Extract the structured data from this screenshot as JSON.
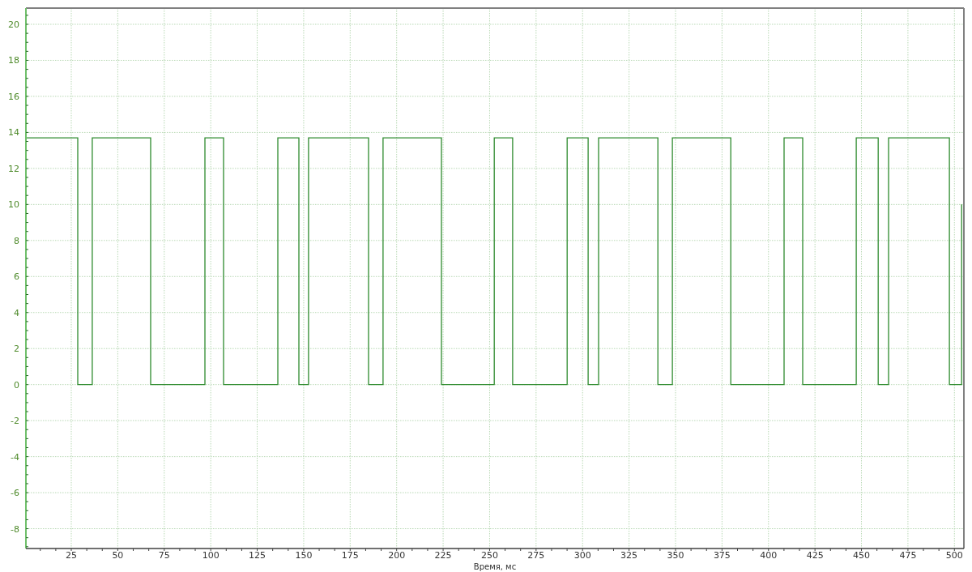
{
  "chart_data": {
    "type": "line",
    "grid": true,
    "xlabel": "Время, мс",
    "xlim": [
      0.6,
      505.1
    ],
    "ylim": [
      -9.1,
      20.9
    ],
    "xticks": [
      25,
      50,
      75,
      100,
      125,
      150,
      175,
      200,
      225,
      250,
      275,
      300,
      325,
      350,
      375,
      400,
      425,
      450,
      475,
      500
    ],
    "yticks": [
      -8,
      -6,
      -4,
      -2,
      0,
      2,
      4,
      6,
      8,
      10,
      12,
      14,
      16,
      18,
      20
    ],
    "x": [
      0.6,
      28.5,
      28.5,
      36.3,
      36.3,
      67.7,
      67.7,
      96.9,
      96.9,
      106.9,
      106.9,
      136.1,
      136.1,
      147.4,
      147.4,
      152.6,
      152.6,
      184.9,
      184.9,
      192.7,
      192.7,
      224.1,
      224.1,
      252.5,
      252.5,
      262.4,
      262.4,
      291.7,
      291.7,
      303,
      303,
      308.6,
      308.6,
      340.5,
      340.5,
      348.3,
      348.3,
      379.7,
      379.7,
      408.4,
      408.4,
      418.4,
      418.4,
      447.2,
      447.2,
      459,
      459,
      464.6,
      464.6,
      497.3,
      497.3,
      503.9,
      503.9
    ],
    "series": [
      {
        "color": "#2e8b2e",
        "values": [
          13.7,
          13.7,
          0,
          0,
          13.7,
          13.7,
          0,
          0,
          13.7,
          13.7,
          0,
          0,
          13.7,
          13.7,
          0,
          0,
          13.7,
          13.7,
          0,
          0,
          13.7,
          13.7,
          0,
          0,
          13.7,
          13.7,
          0,
          0,
          13.7,
          13.7,
          0,
          0,
          13.7,
          13.7,
          0,
          0,
          13.7,
          13.7,
          0,
          0,
          13.7,
          13.7,
          0,
          0,
          13.7,
          13.7,
          0,
          0,
          13.7,
          13.7,
          0,
          0,
          10
        ]
      }
    ]
  }
}
